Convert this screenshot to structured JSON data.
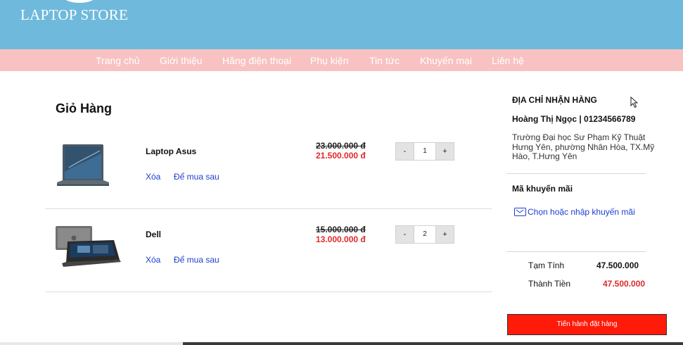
{
  "brand": {
    "name": "LAPTOP STORE"
  },
  "nav": [
    {
      "label": "Trang chủ"
    },
    {
      "label": "Giới thiệu"
    },
    {
      "label": "Hãng điện thoại"
    },
    {
      "label": "Phụ kiện"
    },
    {
      "label": "Tin tức"
    },
    {
      "label": "Khuyến mại"
    },
    {
      "label": "Liên hệ"
    }
  ],
  "cart": {
    "title": "Giỏ Hàng",
    "items": [
      {
        "name": "Laptop Asus",
        "image": "laptop-asus-thumbnail",
        "delete_label": "Xóa",
        "save_label": "Để mua sau",
        "old_price": "23.000.000 đ",
        "price": "21.500.000 đ",
        "qty_minus": "-",
        "quantity": "1",
        "qty_plus": "+"
      },
      {
        "name": "Dell",
        "image": "laptop-dell-thumbnail",
        "delete_label": "Xóa",
        "save_label": "Để mua sau",
        "old_price": "15.000.000 đ",
        "price": "13.000.000 đ",
        "qty_minus": "-",
        "quantity": "2",
        "qty_plus": "+"
      }
    ]
  },
  "sidebar": {
    "address_heading": "ĐỊA CHỈ NHẬN HÀNG",
    "recipient": "Hoàng Thị Ngọc | 01234566789",
    "address": "Trường Đại học Sư Phạm Kỹ Thuật Hưng Yên, phường Nhân Hòa, TX.Mỹ Hào, T.Hưng Yên",
    "promo_heading": "Mã khuyến mãi",
    "promo_link": "Chọn hoặc nhập khuyến mãi",
    "subtotal_label": "Tạm Tính",
    "subtotal_value": "47.500.000",
    "total_label": "Thành Tiền",
    "total_value": "47.500.000",
    "checkout_label": "Tiến hành đặt hàng"
  },
  "colors": {
    "header_bg": "#6fbadc",
    "nav_bg": "#f8c2c2",
    "price_red": "#e0282b",
    "link_blue": "#1f3fcf",
    "checkout_bg": "#ff1a0a"
  }
}
